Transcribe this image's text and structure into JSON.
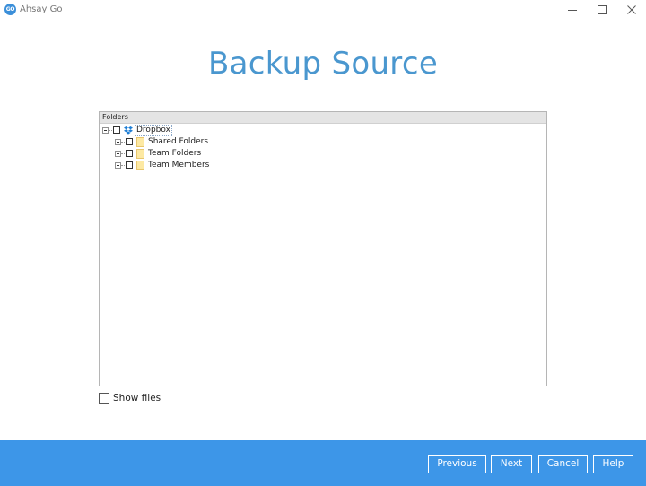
{
  "window": {
    "logo_text": "GO",
    "title": "Ahsay Go"
  },
  "page": {
    "heading": "Backup Source"
  },
  "tree": {
    "header": "Folders",
    "root": {
      "label": "Dropbox",
      "icon": "dropbox-icon",
      "expanded": true,
      "checked": false
    },
    "children": [
      {
        "label": "Shared Folders",
        "icon": "folder-icon",
        "expanded": false,
        "checked": false
      },
      {
        "label": "Team Folders",
        "icon": "folder-icon",
        "expanded": false,
        "checked": false
      },
      {
        "label": "Team Members",
        "icon": "folder-icon",
        "expanded": false,
        "checked": false
      }
    ]
  },
  "options": {
    "show_files_label": "Show files",
    "show_files_checked": false
  },
  "footer": {
    "previous": "Previous",
    "next": "Next",
    "cancel": "Cancel",
    "help": "Help"
  },
  "colors": {
    "accent": "#4a97cf",
    "footer_bg": "#3d96e8",
    "folder": "#fde9a3",
    "dropbox": "#1f7fd6"
  }
}
